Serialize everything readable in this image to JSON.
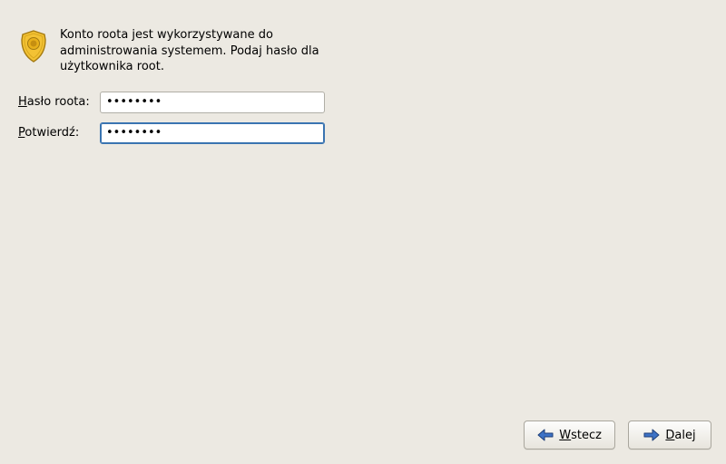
{
  "description": "Konto roota jest wykorzystywane do administrowania systemem. Podaj hasło dla użytkownika root.",
  "form": {
    "password": {
      "label_first": "H",
      "label_rest": "asło roota:",
      "value": "••••••••"
    },
    "confirm": {
      "label_first": "P",
      "label_rest": "otwierdź:",
      "value": "••••••••"
    }
  },
  "buttons": {
    "back": {
      "first": "W",
      "rest": "stecz"
    },
    "next": {
      "first": "D",
      "rest": "alej"
    }
  },
  "icons": {
    "shield": "shield-icon",
    "arrow_left": "arrow-left-icon",
    "arrow_right": "arrow-right-icon"
  }
}
